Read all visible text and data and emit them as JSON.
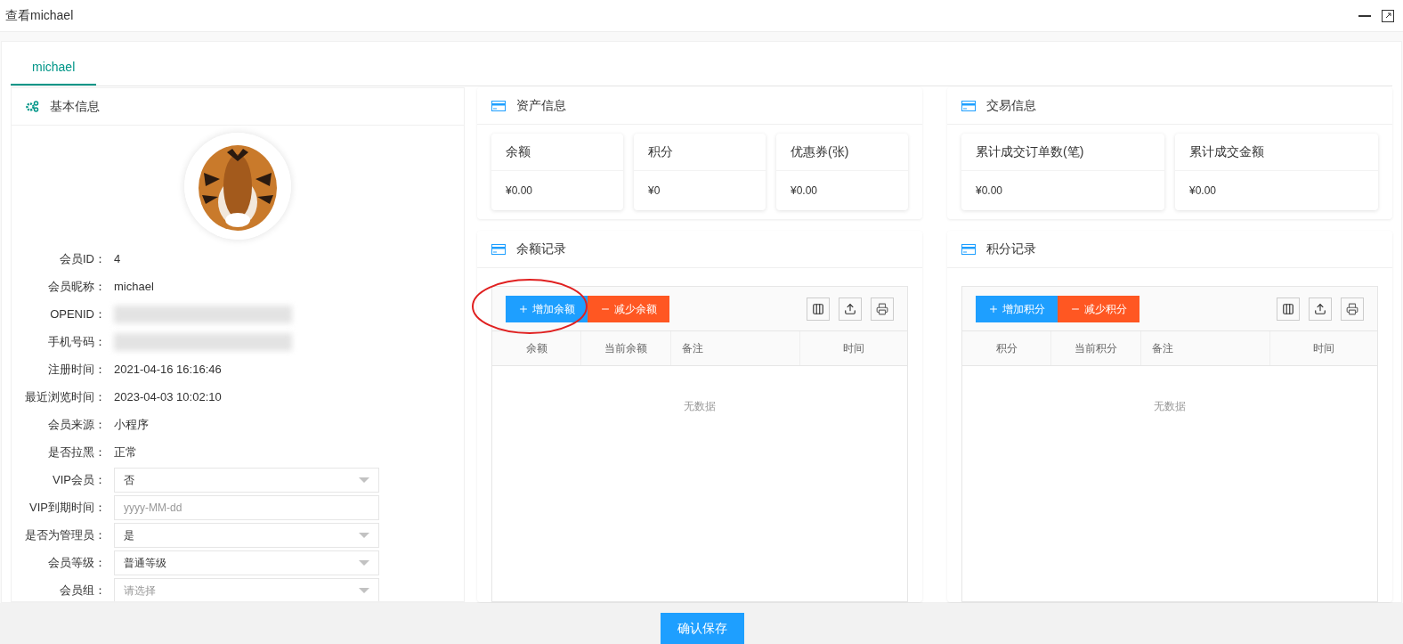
{
  "window": {
    "title": "查看michael"
  },
  "tabs": [
    {
      "label": "michael",
      "selected": true
    }
  ],
  "basic_info": {
    "title": "基本信息",
    "fields": [
      {
        "kind": "text",
        "label": "会员ID：",
        "value": "4"
      },
      {
        "kind": "text",
        "label": "会员昵称：",
        "value": "michael"
      },
      {
        "kind": "redacted",
        "label": "OPENID："
      },
      {
        "kind": "redacted",
        "label": "手机号码："
      },
      {
        "kind": "text",
        "label": "注册时间：",
        "value": "2021-04-16 16:16:46"
      },
      {
        "kind": "text",
        "label": "最近浏览时间：",
        "value": "2023-04-03 10:02:10"
      },
      {
        "kind": "text",
        "label": "会员来源：",
        "value": "小程序"
      },
      {
        "kind": "text",
        "label": "是否拉黑：",
        "value": "正常"
      },
      {
        "kind": "select",
        "label": "VIP会员：",
        "value": "否"
      },
      {
        "kind": "date",
        "label": "VIP到期时间：",
        "placeholder": "yyyy-MM-dd"
      },
      {
        "kind": "select",
        "label": "是否为管理员：",
        "value": "是"
      },
      {
        "kind": "select",
        "label": "会员等级：",
        "value": "普通等级"
      },
      {
        "kind": "select",
        "label": "会员组：",
        "placeholder": "请选择"
      }
    ]
  },
  "asset_info": {
    "title": "资产信息",
    "cards": [
      {
        "label": "余额",
        "value": "¥0.00"
      },
      {
        "label": "积分",
        "value": "¥0"
      },
      {
        "label": "优惠券(张)",
        "value": "¥0.00"
      }
    ]
  },
  "trade_info": {
    "title": "交易信息",
    "cards": [
      {
        "label": "累计成交订单数(笔)",
        "value": "¥0.00"
      },
      {
        "label": "累计成交金额",
        "value": "¥0.00"
      }
    ]
  },
  "balance_records": {
    "title": "余额记录",
    "buttons": [
      {
        "kind": "add",
        "label": "增加余额"
      },
      {
        "kind": "subtract",
        "label": "减少余额"
      }
    ],
    "columns": [
      "余额",
      "当前余额",
      "备注",
      "时间"
    ],
    "empty_text": "无数据"
  },
  "points_records": {
    "title": "积分记录",
    "buttons": [
      {
        "kind": "add",
        "label": "增加积分"
      },
      {
        "kind": "subtract",
        "label": "减少积分"
      }
    ],
    "columns": [
      "积分",
      "当前积分",
      "备注",
      "时间"
    ],
    "empty_text": "无数据"
  },
  "footer": {
    "button": "确认保存"
  }
}
